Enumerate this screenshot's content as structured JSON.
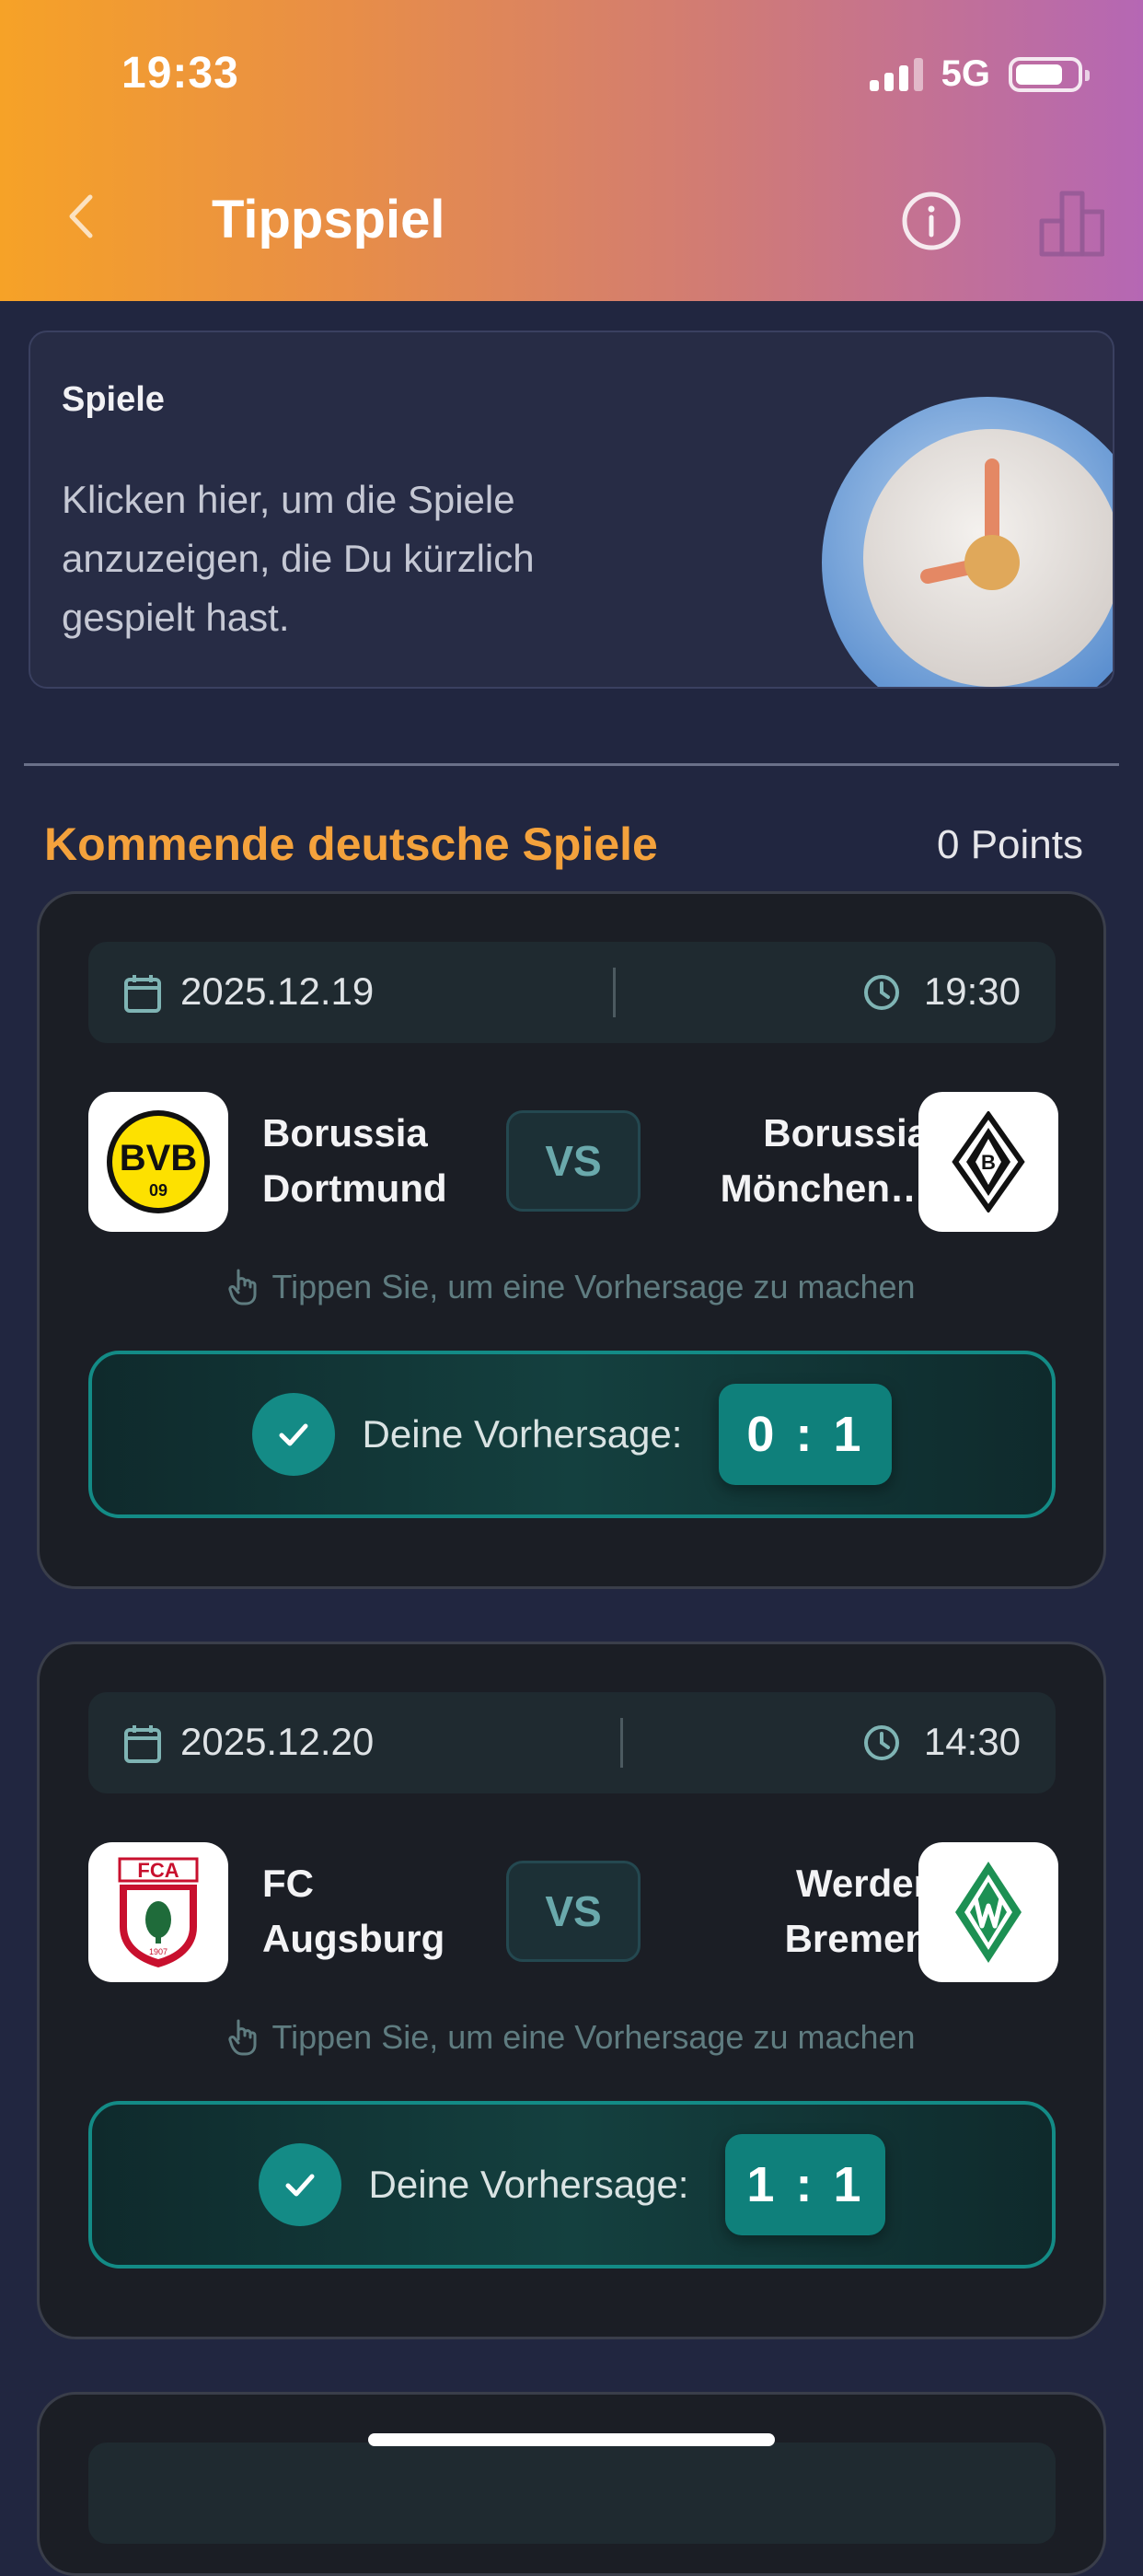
{
  "status_bar": {
    "time": "19:33",
    "network": "5G"
  },
  "header": {
    "title": "Tippspiel"
  },
  "recent_card": {
    "title": "Spiele",
    "description": "Klicken hier, um die Spiele anzuzeigen, die Du kürzlich gespielt hast."
  },
  "section": {
    "title": "Kommende deutsche Spiele",
    "points": "0 Points"
  },
  "matches": [
    {
      "date": "2025.12.19",
      "time": "19:30",
      "home": "Borussia Dortmund",
      "away": "Borussia Mönchen…",
      "vs": "VS",
      "hint": "Tippen Sie, um eine Vorhersage zu machen",
      "prediction_label": "Deine Vorhersage:",
      "prediction": "0 : 1",
      "home_logo": {
        "text": "BVB",
        "sub": "09"
      }
    },
    {
      "date": "2025.12.20",
      "time": "14:30",
      "home": "FC Augsburg",
      "away": "Werder Bremen",
      "vs": "VS",
      "hint": "Tippen Sie, um eine Vorhersage zu machen",
      "prediction_label": "Deine Vorhersage:",
      "prediction": "1 : 1",
      "home_logo": {
        "text": "FCA",
        "sub": "1907"
      }
    }
  ],
  "colors": {
    "accent": "#f4a23c",
    "teal": "#138b86",
    "background": "#212640"
  }
}
